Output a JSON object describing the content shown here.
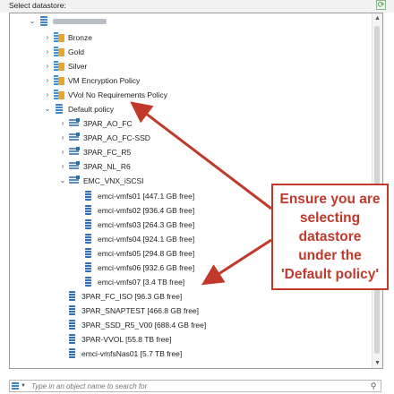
{
  "header": {
    "title": "Select datastore:"
  },
  "tree": {
    "host": {
      "label": ""
    },
    "policies": [
      {
        "label": "Bronze"
      },
      {
        "label": "Gold"
      },
      {
        "label": "Silver"
      },
      {
        "label": "VM Encryption Policy"
      },
      {
        "label": "VVol No Requirements Policy"
      },
      {
        "label": "Default policy"
      }
    ],
    "clusters": [
      {
        "label": "3PAR_AO_FC"
      },
      {
        "label": "3PAR_AO_FC-SSD"
      },
      {
        "label": "3PAR_FC_R5"
      },
      {
        "label": "3PAR_NL_R6"
      },
      {
        "label": "EMC_VNX_iSCSI"
      }
    ],
    "vnx_datastores": [
      {
        "label": "emci-vmfs01 [447.1 GB free]"
      },
      {
        "label": "emci-vmfs02 [936.4 GB free]"
      },
      {
        "label": "emci-vmfs03 [264.3 GB free]"
      },
      {
        "label": "emci-vmfs04 [924.1 GB free]"
      },
      {
        "label": "emci-vmfs05 [294.8 GB free]"
      },
      {
        "label": "emci-vmfs06 [932.6 GB free]"
      },
      {
        "label": "emci-vmfs07 [3.4 TB free]"
      }
    ],
    "other_datastores": [
      {
        "label": "3PAR_FC_ISO [96.3 GB free]"
      },
      {
        "label": "3PAR_SNAPTEST [466.8 GB free]"
      },
      {
        "label": "3PAR_SSD_R5_V00 [688.4 GB free]"
      },
      {
        "label": "3PAR-VVOL [55.8 TB free]"
      },
      {
        "label": "emci-vmfsNas01 [5.7 TB free]"
      }
    ]
  },
  "search": {
    "placeholder": "Type in an object name to search for"
  },
  "annotation": {
    "lines": [
      "Ensure you are",
      "selecting",
      "datastore",
      "under the",
      "'Default policy'"
    ],
    "color": "#c0392b"
  },
  "icons": {
    "refresh": "refresh-icon",
    "expand": "chevron-down-icon",
    "collapse": "chevron-right-icon",
    "search": "search-icon"
  }
}
